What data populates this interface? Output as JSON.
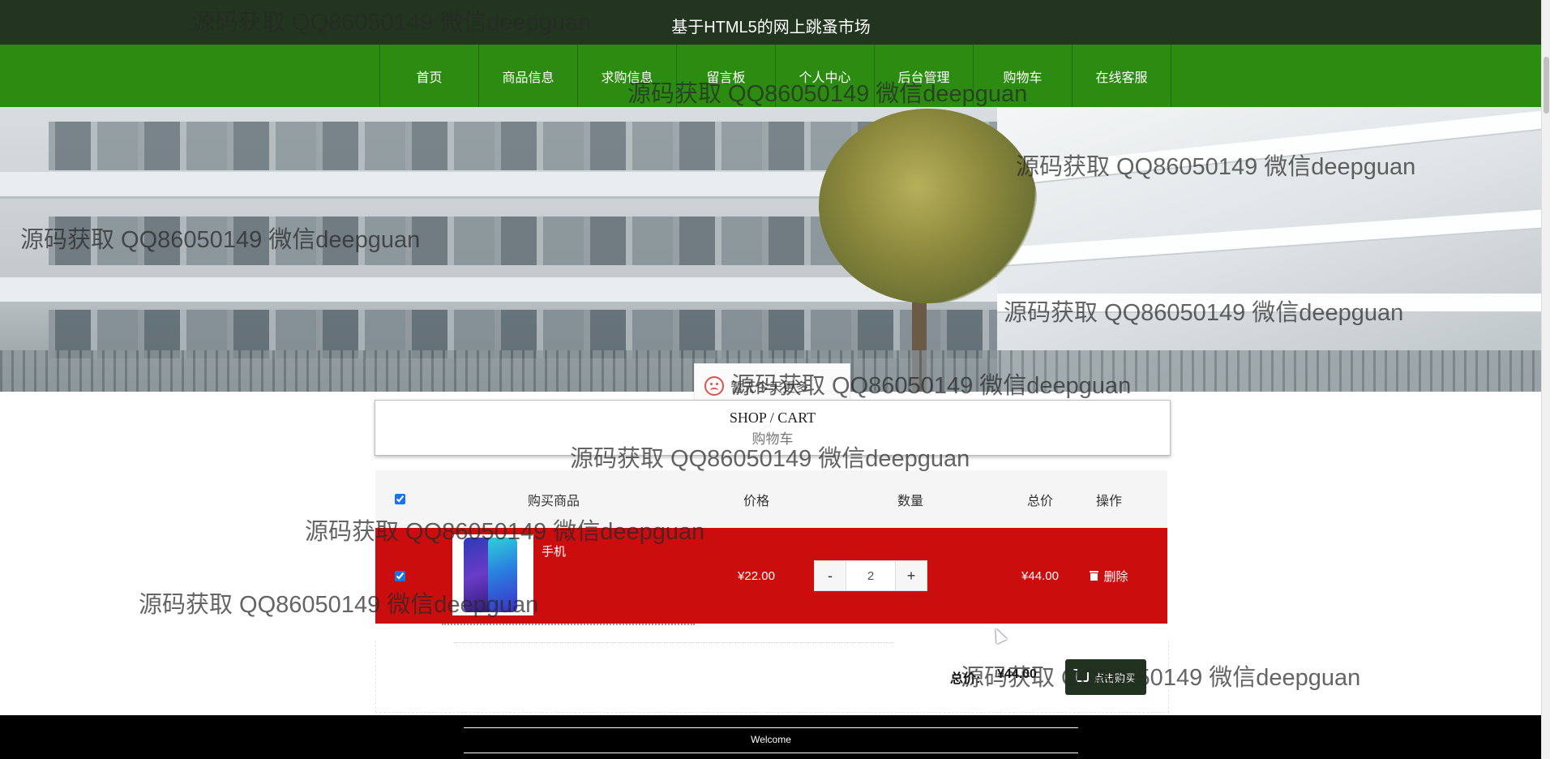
{
  "header": {
    "site_title": "基于HTML5的网上跳蚤市场"
  },
  "nav": {
    "items": [
      {
        "label": "首页"
      },
      {
        "label": "商品信息"
      },
      {
        "label": "求购信息"
      },
      {
        "label": "留言板"
      },
      {
        "label": "个人中心"
      },
      {
        "label": "后台管理"
      },
      {
        "label": "购物车"
      },
      {
        "label": "在线客服"
      }
    ]
  },
  "notice": {
    "message": "暂无今天更多",
    "icon": "sad-face-icon"
  },
  "cart_section": {
    "title_en": "SHOP / CART",
    "title_cn": "购物车"
  },
  "table": {
    "headers": {
      "goods": "购买商品",
      "price": "价格",
      "quantity": "数量",
      "total": "总价",
      "action": "操作"
    },
    "rows": [
      {
        "name": "手机",
        "price": "¥22.00",
        "quantity": "2",
        "total": "¥44.00",
        "delete_label": "删除",
        "checked": true
      }
    ]
  },
  "summary": {
    "total_label": "总价:",
    "total_value": "¥44.00",
    "buy_label": "点击购买"
  },
  "footer": {
    "welcome": "Welcome"
  },
  "watermark": {
    "text": "源码获取 QQ86050149 微信deepguan"
  },
  "colors": {
    "topbar": "#22361f",
    "navbar": "#2c8c12",
    "cart_row": "#cc0d0d",
    "buy_button": "#20331e",
    "footer": "#000000"
  }
}
